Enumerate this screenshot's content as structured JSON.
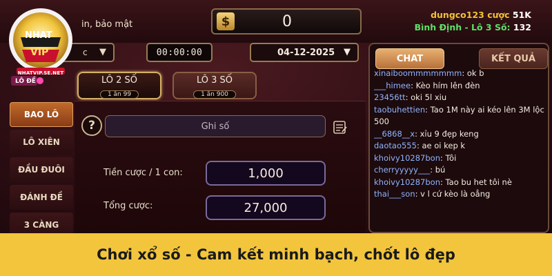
{
  "header": {
    "subtitle": "in, bảo mật",
    "balance_symbol": "$",
    "balance": "0",
    "user_name": "dungco123",
    "user_bet_label": "cược",
    "user_bet_value": "51K",
    "region_label": "Bình Định - Lô 3 Số:",
    "region_value": "132"
  },
  "logo": {
    "brand_top": "NHAT",
    "brand_bottom": "VIP",
    "site": "NHATVIP.SE.NET",
    "section": "LÔ ĐỀ"
  },
  "controls": {
    "left_select_value": "c",
    "timer": "00:00:00",
    "date": "04-12-2025"
  },
  "tabs": [
    {
      "label": "LÔ 2 SỐ",
      "odds": "1 ăn 99"
    },
    {
      "label": "LÔ 3 SỐ",
      "odds": "1 ăn 900"
    }
  ],
  "side_menu": [
    "BAO LÔ",
    "LÔ XIÊN",
    "ĐẦU ĐUÔI",
    "ĐÁNH ĐỀ",
    "3 CÀNG"
  ],
  "form": {
    "help_icon": "?",
    "note_placeholder": "Ghi số",
    "bet_per_label": "Tiền cược / 1 con:",
    "bet_per_value": "1,000",
    "total_label": "Tổng cược:",
    "total_value": "27,000"
  },
  "chat": {
    "tab_chat": "CHAT",
    "tab_result": "KẾT QUẢ",
    "messages": [
      {
        "user": "xinaiboommmmmmm",
        "text": "ok b"
      },
      {
        "user": "___himee",
        "text": "Kèo hím lên đèn"
      },
      {
        "user": "23456tt",
        "text": "oki 5l xiu"
      },
      {
        "user": "taobuhettien",
        "text": "Tao 1M này ai kéo lên 3M lộc 500"
      },
      {
        "user": "__6868__x",
        "text": "xỉu 9 đẹp keng"
      },
      {
        "user": "daotao555",
        "text": "ae oi kep k"
      },
      {
        "user": "khoivy10287bon",
        "text": "Tôi"
      },
      {
        "user": "cherryyyyy___",
        "text": "bú"
      },
      {
        "user": "khoivy10287bon",
        "text": "Tao bu het tôi nè"
      },
      {
        "user": "thai___son",
        "text": "v l cứ kèo là oẳng"
      }
    ]
  },
  "banner": {
    "text": "Chơi xổ số - Cam kết minh bạch, chốt lô đẹp"
  },
  "colors": {
    "banner_bg": "#f2c53d",
    "accent_gold": "#d6b066",
    "chat_user": "#8fb4ff",
    "user_name": "#f0c23a",
    "region": "#5fe06a"
  }
}
